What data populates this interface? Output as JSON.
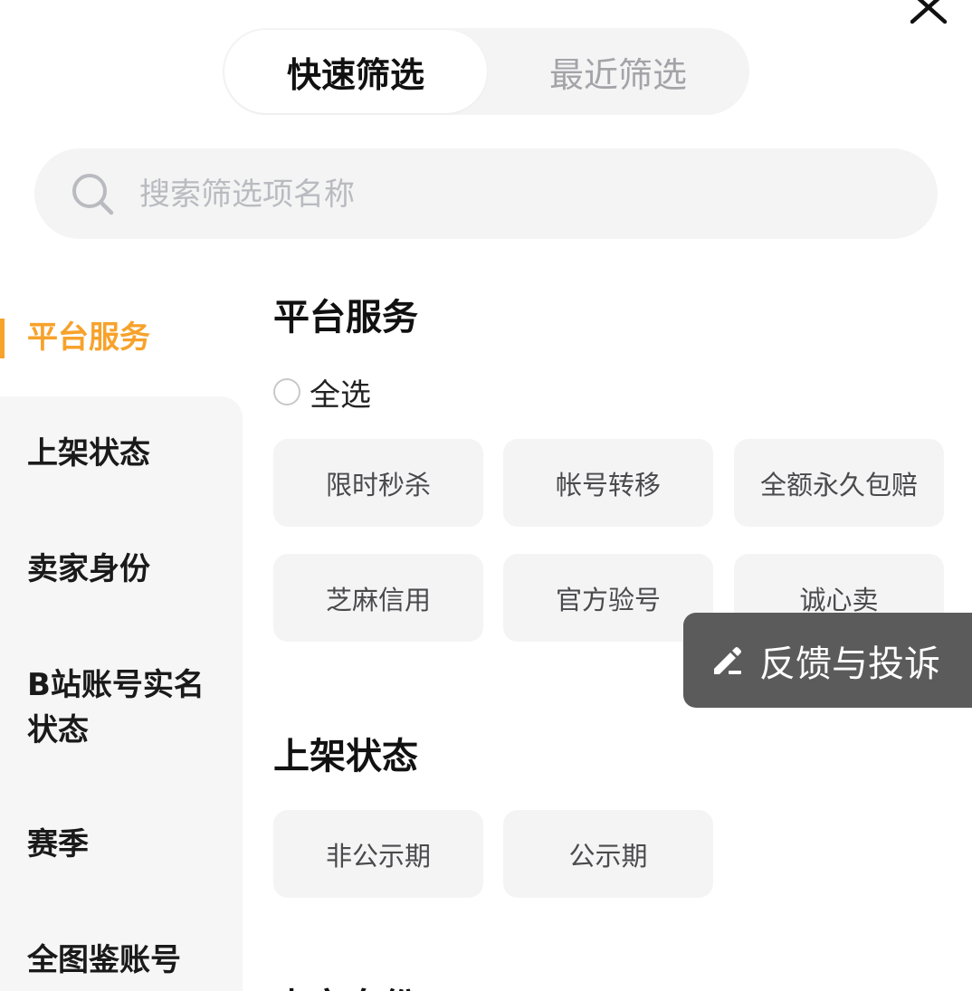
{
  "close": {
    "icon": "close-icon"
  },
  "tabs": [
    {
      "label": "快速筛选",
      "active": true
    },
    {
      "label": "最近筛选",
      "active": false
    }
  ],
  "search": {
    "placeholder": "搜索筛选项名称",
    "icon": "search-icon"
  },
  "sidebar": {
    "items": [
      {
        "label": "平台服务",
        "active": true
      },
      {
        "label": "上架状态"
      },
      {
        "label": "卖家身份"
      },
      {
        "label": "B站账号实名状态"
      },
      {
        "label": "赛季"
      },
      {
        "label": "全图鉴账号"
      }
    ]
  },
  "sections": [
    {
      "title": "平台服务",
      "select_all": "全选",
      "options": [
        "限时秒杀",
        "帐号转移",
        "全额永久包赔",
        "芝麻信用",
        "官方验号",
        "诚心卖"
      ]
    },
    {
      "title": "上架状态",
      "options": [
        "非公示期",
        "公示期"
      ]
    },
    {
      "title": "卖家身份"
    }
  ],
  "feedback": {
    "label": "反馈与投诉",
    "icon": "edit-icon"
  },
  "colors": {
    "accent": "#f7a22b",
    "chip_bg": "#f4f4f5",
    "feedback_bg": "#5b5b5b"
  }
}
